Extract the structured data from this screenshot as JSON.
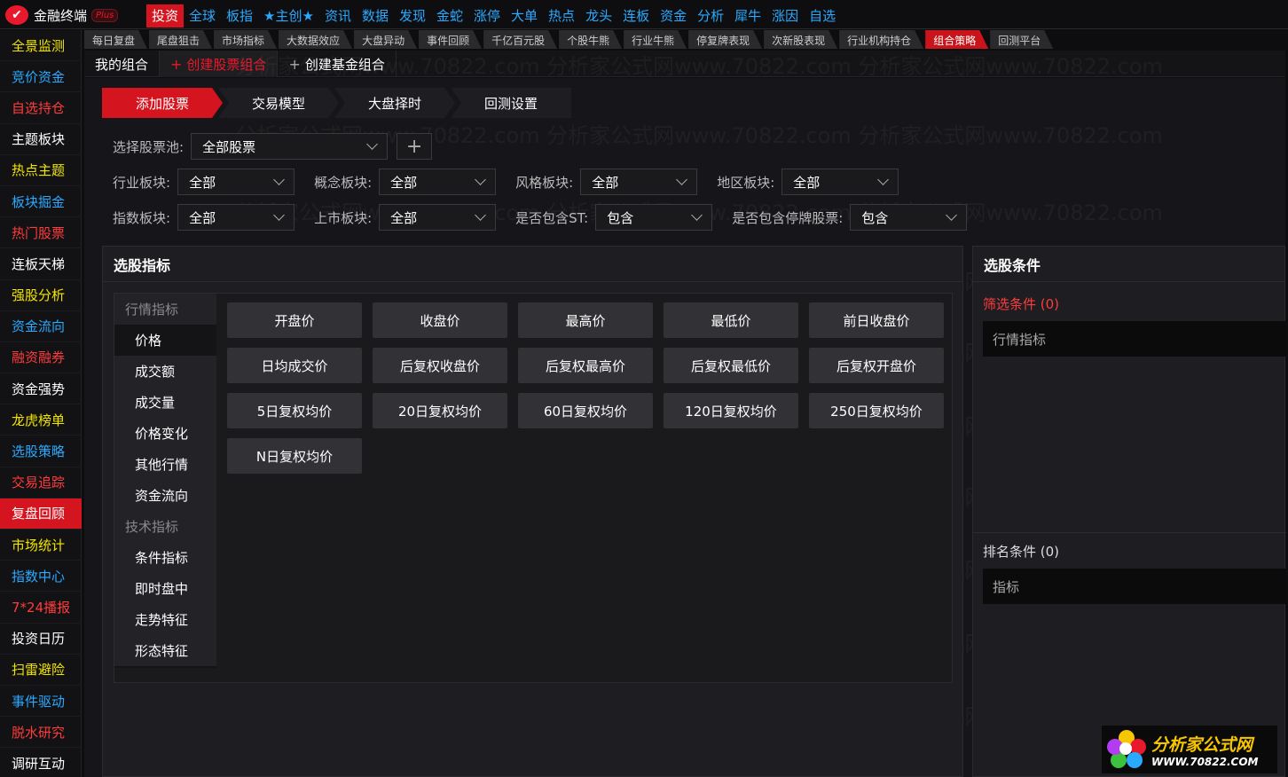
{
  "app": {
    "name": "金融终端",
    "badge": "Plus"
  },
  "topmenu": [
    {
      "label": "投资",
      "active": true
    },
    {
      "label": "全球"
    },
    {
      "label": "板指"
    },
    {
      "label": "★主创★"
    },
    {
      "label": "资讯"
    },
    {
      "label": "数据"
    },
    {
      "label": "发现"
    },
    {
      "label": "金蛇"
    },
    {
      "label": "涨停"
    },
    {
      "label": "大单"
    },
    {
      "label": "热点"
    },
    {
      "label": "龙头"
    },
    {
      "label": "连板"
    },
    {
      "label": "资金"
    },
    {
      "label": "分析"
    },
    {
      "label": "犀牛"
    },
    {
      "label": "涨因"
    },
    {
      "label": "自选"
    }
  ],
  "sidebar": [
    {
      "label": "全景监测",
      "color": "#f2e600"
    },
    {
      "label": "竞价资金",
      "color": "#2aa9ff"
    },
    {
      "label": "自选持仓",
      "color": "#ff3b3b"
    },
    {
      "label": "主题板块",
      "color": "#ffffff"
    },
    {
      "label": "热点主题",
      "color": "#f2e600"
    },
    {
      "label": "板块掘金",
      "color": "#2aa9ff"
    },
    {
      "label": "热门股票",
      "color": "#ff3b3b"
    },
    {
      "label": "连板天梯",
      "color": "#ffffff"
    },
    {
      "label": "强股分析",
      "color": "#f2e600"
    },
    {
      "label": "资金流向",
      "color": "#2aa9ff"
    },
    {
      "label": "融资融券",
      "color": "#ff3b3b"
    },
    {
      "label": "资金强势",
      "color": "#ffffff"
    },
    {
      "label": "龙虎榜单",
      "color": "#f2e600"
    },
    {
      "label": "选股策略",
      "color": "#2aa9ff"
    },
    {
      "label": "交易追踪",
      "color": "#ff3b3b"
    },
    {
      "label": "复盘回顾",
      "color": "#ffffff",
      "active": true
    },
    {
      "label": "市场统计",
      "color": "#f2e600"
    },
    {
      "label": "指数中心",
      "color": "#2aa9ff"
    },
    {
      "label": "7*24播报",
      "color": "#ff3b3b"
    },
    {
      "label": "投资日历",
      "color": "#ffffff"
    },
    {
      "label": "扫雷避险",
      "color": "#f2e600"
    },
    {
      "label": "事件驱动",
      "color": "#2aa9ff"
    },
    {
      "label": "脱水研究",
      "color": "#ff3b3b"
    },
    {
      "label": "调研互动",
      "color": "#ffffff"
    }
  ],
  "subtabs": [
    {
      "label": "每日复盘"
    },
    {
      "label": "尾盘狙击"
    },
    {
      "label": "市场指标"
    },
    {
      "label": "大数据效应"
    },
    {
      "label": "大盘异动"
    },
    {
      "label": "事件回顾"
    },
    {
      "label": "千亿百元股"
    },
    {
      "label": "个股牛熊"
    },
    {
      "label": "行业牛熊"
    },
    {
      "label": "停复牌表现"
    },
    {
      "label": "次新股表现"
    },
    {
      "label": "行业机构持仓"
    },
    {
      "label": "组合策略",
      "active": true
    },
    {
      "label": "回测平台"
    }
  ],
  "portfolio_tabs": {
    "my": "我的组合",
    "create_stock": "创建股票组合",
    "create_fund": "创建基金组合",
    "plus": "+"
  },
  "steps": [
    "添加股票",
    "交易模型",
    "大盘择时",
    "回测设置"
  ],
  "filters": {
    "pool_label": "选择股票池:",
    "pool_value": "全部股票",
    "plus": "+",
    "industry_label": "行业板块:",
    "industry_value": "全部",
    "concept_label": "概念板块:",
    "concept_value": "全部",
    "style_label": "风格板块:",
    "style_value": "全部",
    "region_label": "地区板块:",
    "region_value": "全部",
    "index_label": "指数板块:",
    "index_value": "全部",
    "listing_label": "上市板块:",
    "listing_value": "全部",
    "st_label": "是否包含ST:",
    "st_value": "包含",
    "suspended_label": "是否包含停牌股票:",
    "suspended_value": "包含"
  },
  "indicator_panel": {
    "title": "选股指标",
    "categories": [
      {
        "label": "行情指标",
        "header": true
      },
      {
        "label": "价格",
        "selected": true
      },
      {
        "label": "成交额"
      },
      {
        "label": "成交量"
      },
      {
        "label": "价格变化"
      },
      {
        "label": "其他行情"
      },
      {
        "label": "资金流向"
      },
      {
        "label": "技术指标",
        "header": true
      },
      {
        "label": "条件指标"
      },
      {
        "label": "即时盘中"
      },
      {
        "label": "走势特征"
      },
      {
        "label": "形态特征"
      }
    ],
    "buttons": [
      "开盘价",
      "收盘价",
      "最高价",
      "最低价",
      "前日收盘价",
      "日均成交价",
      "后复权收盘价",
      "后复权最高价",
      "后复权最低价",
      "后复权开盘价",
      "5日复权均价",
      "20日复权均价",
      "60日复权均价",
      "120日复权均价",
      "250日复权均价",
      "N日复权均价"
    ]
  },
  "condition_panel": {
    "title": "选股条件",
    "filter_label": "筛选条件 (0)",
    "filter_box": "行情指标",
    "rank_label": "排名条件 (0)",
    "rank_box": "指标"
  },
  "watermark": "分析家公式网www.70822.com   分析家公式网www.70822.com   分析家公式网www.70822.com",
  "brand": {
    "name": "分析家公式网",
    "url": "WWW.70822.COM"
  },
  "colors": {
    "accent_red": "#d4141f",
    "link_blue": "#2aa9ff",
    "yellow": "#f2e600"
  }
}
